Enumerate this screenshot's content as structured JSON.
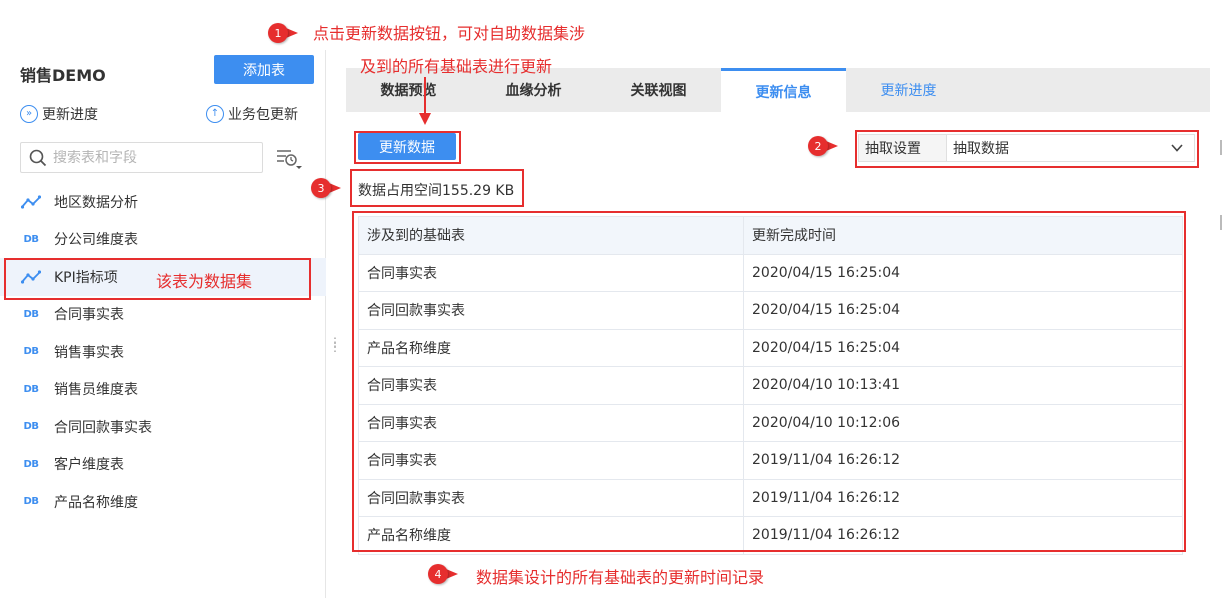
{
  "sidebar": {
    "title": "销售DEMO",
    "add_table_label": "添加表",
    "update_progress_label": "更新进度",
    "package_update_label": "业务包更新",
    "search_placeholder": "搜索表和字段",
    "tables": [
      {
        "label": "地区数据分析",
        "icon": "dataset-icon"
      },
      {
        "label": "分公司维度表",
        "icon": "db-icon"
      },
      {
        "label": "KPI指标项",
        "icon": "dataset-icon",
        "selected": true
      },
      {
        "label": "合同事实表",
        "icon": "db-icon"
      },
      {
        "label": "销售事实表",
        "icon": "db-icon"
      },
      {
        "label": "销售员维度表",
        "icon": "db-icon"
      },
      {
        "label": "合同回款事实表",
        "icon": "db-icon"
      },
      {
        "label": "客户维度表",
        "icon": "db-icon"
      },
      {
        "label": "产品名称维度",
        "icon": "db-icon"
      }
    ],
    "db_icon_text": "DB"
  },
  "main": {
    "tabs": [
      {
        "label": "数据预览"
      },
      {
        "label": "血缘分析"
      },
      {
        "label": "关联视图"
      },
      {
        "label": "更新信息",
        "active": true
      },
      {
        "label": "更新进度"
      }
    ],
    "update_button_label": "更新数据",
    "extract_label": "抽取设置",
    "extract_value": "抽取数据",
    "space_text": "数据占用空间155.29 KB",
    "table_headers": [
      "涉及到的基础表",
      "更新完成时间"
    ],
    "rows": [
      [
        "合同事实表",
        "2020/04/15 16:25:04"
      ],
      [
        "合同回款事实表",
        "2020/04/15 16:25:04"
      ],
      [
        "产品名称维度",
        "2020/04/15 16:25:04"
      ],
      [
        "合同事实表",
        "2020/04/10 10:13:41"
      ],
      [
        "合同事实表",
        "2020/04/10 10:12:06"
      ],
      [
        "合同事实表",
        "2019/11/04 16:26:12"
      ],
      [
        "合同回款事实表",
        "2019/11/04 16:26:12"
      ],
      [
        "产品名称维度",
        "2019/11/04 16:26:12"
      ]
    ]
  },
  "annotations": {
    "a1_line1": "点击更新数据按钮，可对自助数据集涉",
    "a1_line2": "及到的所有基础表进行更新",
    "dataset_note": "该表为数据集",
    "a4_text": "数据集设计的所有基础表的更新时间记录",
    "numbers": [
      "1",
      "2",
      "3",
      "4"
    ]
  },
  "colors": {
    "accent": "#3d8ef0",
    "annotation": "#e62e2e"
  }
}
